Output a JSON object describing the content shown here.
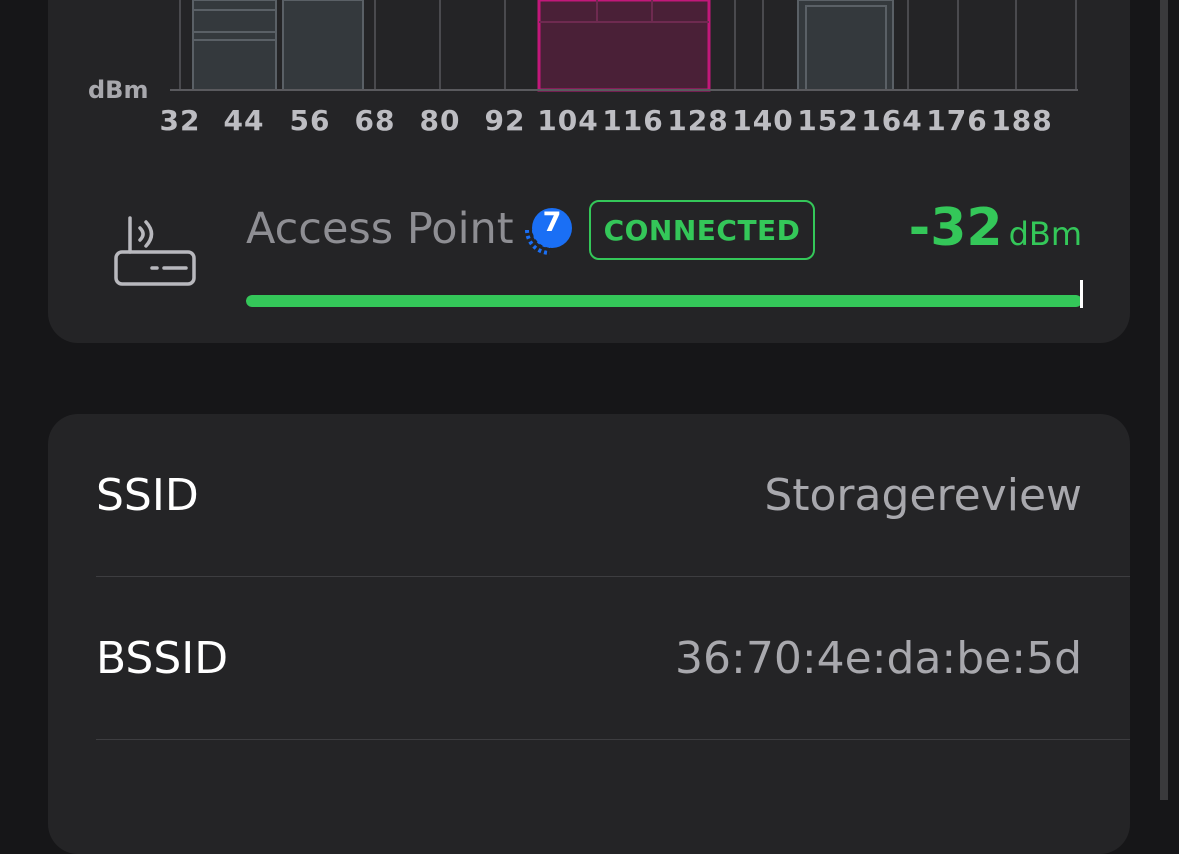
{
  "chart": {
    "y_unit": "dBm",
    "x_ticks": [
      "32",
      "44",
      "56",
      "68",
      "80",
      "92",
      "104",
      "116",
      "128",
      "140",
      "152",
      "164",
      "176",
      "188"
    ],
    "highlight_color": "#c2187a"
  },
  "access_point": {
    "name": "Access Point",
    "wifi_generation": "7",
    "status": "CONNECTED",
    "signal_value": "-32",
    "signal_unit": "dBm",
    "signal_fraction": 1.0
  },
  "info": {
    "rows": [
      {
        "label": "SSID",
        "value": "Storagereview"
      },
      {
        "label": "BSSID",
        "value": "36:70:4e:da:be:5d"
      }
    ]
  },
  "colors": {
    "accent_green": "#34c759",
    "badge_blue": "#1a6ff5"
  }
}
